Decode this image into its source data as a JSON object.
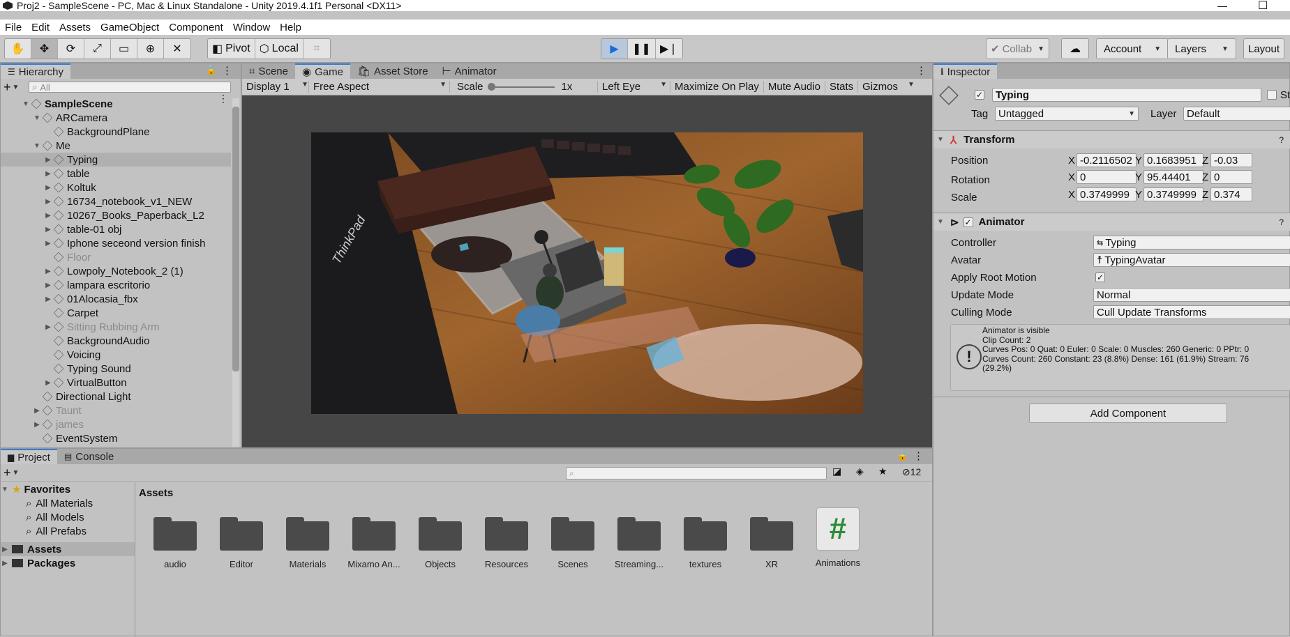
{
  "window": {
    "title": "Proj2 - SampleScene - PC, Mac & Linux Standalone - Unity 2019.4.1f1 Personal <DX11>"
  },
  "menu": [
    "File",
    "Edit",
    "Assets",
    "GameObject",
    "Component",
    "Window",
    "Help"
  ],
  "toolbar": {
    "pivot": "Pivot",
    "local": "Local",
    "collab": "Collab",
    "account": "Account",
    "layers": "Layers",
    "layout": "Layout"
  },
  "hierarchy": {
    "tab": "Hierarchy",
    "search_placeholder": "All",
    "items": [
      {
        "label": "SampleScene",
        "depth": 0,
        "bold": true
      },
      {
        "label": "ARCamera",
        "depth": 1
      },
      {
        "label": "BackgroundPlane",
        "depth": 2
      },
      {
        "label": "Me",
        "depth": 1
      },
      {
        "label": "Typing",
        "depth": 2,
        "selected": true
      },
      {
        "label": "table",
        "depth": 2
      },
      {
        "label": "Koltuk",
        "depth": 2
      },
      {
        "label": "16734_notebook_v1_NEW",
        "depth": 2
      },
      {
        "label": "10267_Books_Paperback_L2",
        "depth": 2
      },
      {
        "label": "table-01 obj",
        "depth": 2
      },
      {
        "label": "Iphone seceond version finish",
        "depth": 2
      },
      {
        "label": "Floor",
        "depth": 2,
        "dim": true
      },
      {
        "label": "Lowpoly_Notebook_2 (1)",
        "depth": 2
      },
      {
        "label": "lampara escritorio",
        "depth": 2
      },
      {
        "label": "01Alocasia_fbx",
        "depth": 2
      },
      {
        "label": "Carpet",
        "depth": 2
      },
      {
        "label": "Sitting Rubbing Arm",
        "depth": 2,
        "dim": true
      },
      {
        "label": "BackgroundAudio",
        "depth": 2
      },
      {
        "label": "Voicing",
        "depth": 2
      },
      {
        "label": "Typing Sound",
        "depth": 2
      },
      {
        "label": "VirtualButton",
        "depth": 2
      },
      {
        "label": "Directional Light",
        "depth": 1
      },
      {
        "label": "Taunt",
        "depth": 1,
        "dim": true
      },
      {
        "label": "james",
        "depth": 1,
        "dim": true
      },
      {
        "label": "EventSystem",
        "depth": 1
      }
    ]
  },
  "scene_tabs": [
    "Scene",
    "Game",
    "Asset Store",
    "Animator"
  ],
  "game_bar": {
    "display": "Display 1",
    "aspect": "Free Aspect",
    "scale_label": "Scale",
    "scale_value": "1x",
    "eye": "Left Eye",
    "maximize": "Maximize On Play",
    "mute": "Mute Audio",
    "stats": "Stats",
    "gizmos": "Gizmos"
  },
  "game_view": {
    "laptop_brand": "ThinkPad"
  },
  "inspector": {
    "tab": "Inspector",
    "object_name": "Typing",
    "static_label": "St",
    "tag_label": "Tag",
    "tag_value": "Untagged",
    "layer_label": "Layer",
    "layer_value": "Default",
    "transform": {
      "title": "Transform",
      "position_label": "Position",
      "position": {
        "x": "-0.2116502",
        "y": "0.1683951",
        "z": "-0.03"
      },
      "rotation_label": "Rotation",
      "rotation": {
        "x": "0",
        "y": "95.44401",
        "z": "0"
      },
      "scale_label": "Scale",
      "scale": {
        "x": "0.3749999",
        "y": "0.3749999",
        "z": "0.374"
      }
    },
    "animator": {
      "title": "Animator",
      "controller_label": "Controller",
      "controller": "Typing",
      "avatar_label": "Avatar",
      "avatar": "TypingAvatar",
      "root_motion_label": "Apply Root Motion",
      "update_mode_label": "Update Mode",
      "update_mode": "Normal",
      "culling_mode_label": "Culling Mode",
      "culling_mode": "Cull Update Transforms",
      "info": [
        "Animator is visible",
        "Clip Count: 2",
        "Curves Pos: 0 Quat: 0 Euler: 0 Scale: 0 Muscles: 260 Generic: 0 PPtr: 0",
        "Curves Count: 260 Constant: 23 (8.8%) Dense: 161 (61.9%) Stream: 76",
        "(29.2%)"
      ]
    },
    "add_component": "Add Component"
  },
  "project": {
    "tabs": [
      "Project",
      "Console"
    ],
    "hidden_count": "12",
    "favorites_label": "Favorites",
    "favorites": [
      "All Materials",
      "All Models",
      "All Prefabs"
    ],
    "roots": [
      "Assets",
      "Packages"
    ],
    "breadcrumb": "Assets",
    "assets": [
      "audio",
      "Editor",
      "Materials",
      "Mixamo An...",
      "Objects",
      "Resources",
      "Scenes",
      "Streaming...",
      "textures",
      "XR",
      "Animations"
    ]
  }
}
